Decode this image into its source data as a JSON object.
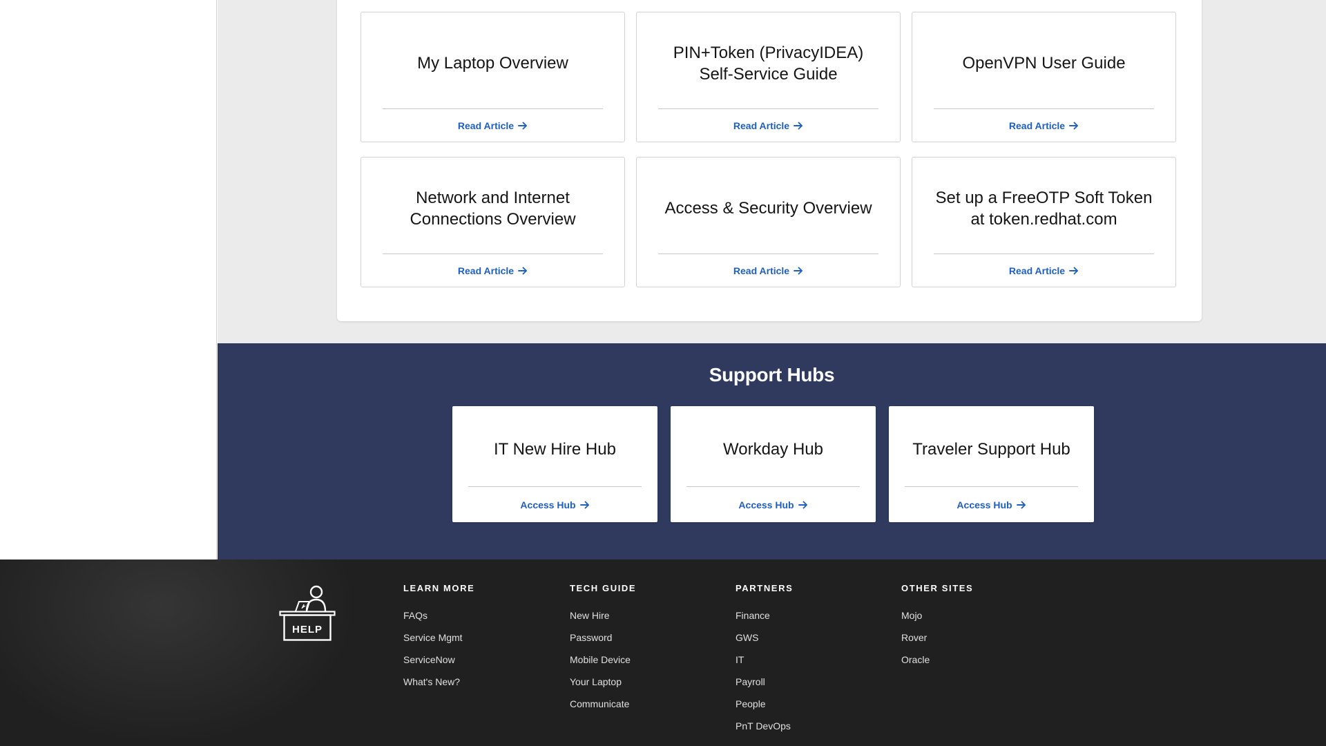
{
  "articles": [
    {
      "title": "My Laptop Overview",
      "link": "Read Article"
    },
    {
      "title": "PIN+Token (PrivacyIDEA) Self-Service Guide",
      "link": "Read Article"
    },
    {
      "title": "OpenVPN User Guide",
      "link": "Read Article"
    },
    {
      "title": "Network and Internet Connections Overview",
      "link": "Read Article"
    },
    {
      "title": "Access & Security Overview",
      "link": "Read Article"
    },
    {
      "title": "Set up a FreeOTP Soft Token at token.redhat.com",
      "link": "Read Article"
    }
  ],
  "hubs": {
    "title": "Support Hubs",
    "items": [
      {
        "title": "IT New Hire Hub",
        "link": "Access Hub"
      },
      {
        "title": "Workday Hub",
        "link": "Access Hub"
      },
      {
        "title": "Traveler Support Hub",
        "link": "Access Hub"
      }
    ]
  },
  "footer": {
    "logo_text": "HELP",
    "columns": [
      {
        "heading": "LEARN MORE",
        "links": [
          "FAQs",
          "Service Mgmt",
          "ServiceNow",
          "What's New?"
        ]
      },
      {
        "heading": "TECH GUIDE",
        "links": [
          "New Hire",
          "Password",
          "Mobile Device",
          "Your Laptop",
          "Communicate"
        ]
      },
      {
        "heading": "PARTNERS",
        "links": [
          "Finance",
          "GWS",
          "IT",
          "Payroll",
          "People",
          "PnT DevOps"
        ]
      },
      {
        "heading": "OTHER SITES",
        "links": [
          "Mojo",
          "Rover",
          "Oracle"
        ]
      }
    ]
  },
  "colors": {
    "link": "#1f5fbf",
    "hubs_bg": "#2f3a5e",
    "footer_bg": "#202020",
    "page_bg": "#ebebeb"
  },
  "icons": {
    "card_link": "arrow-right-icon",
    "logo": "help-desk-icon"
  }
}
